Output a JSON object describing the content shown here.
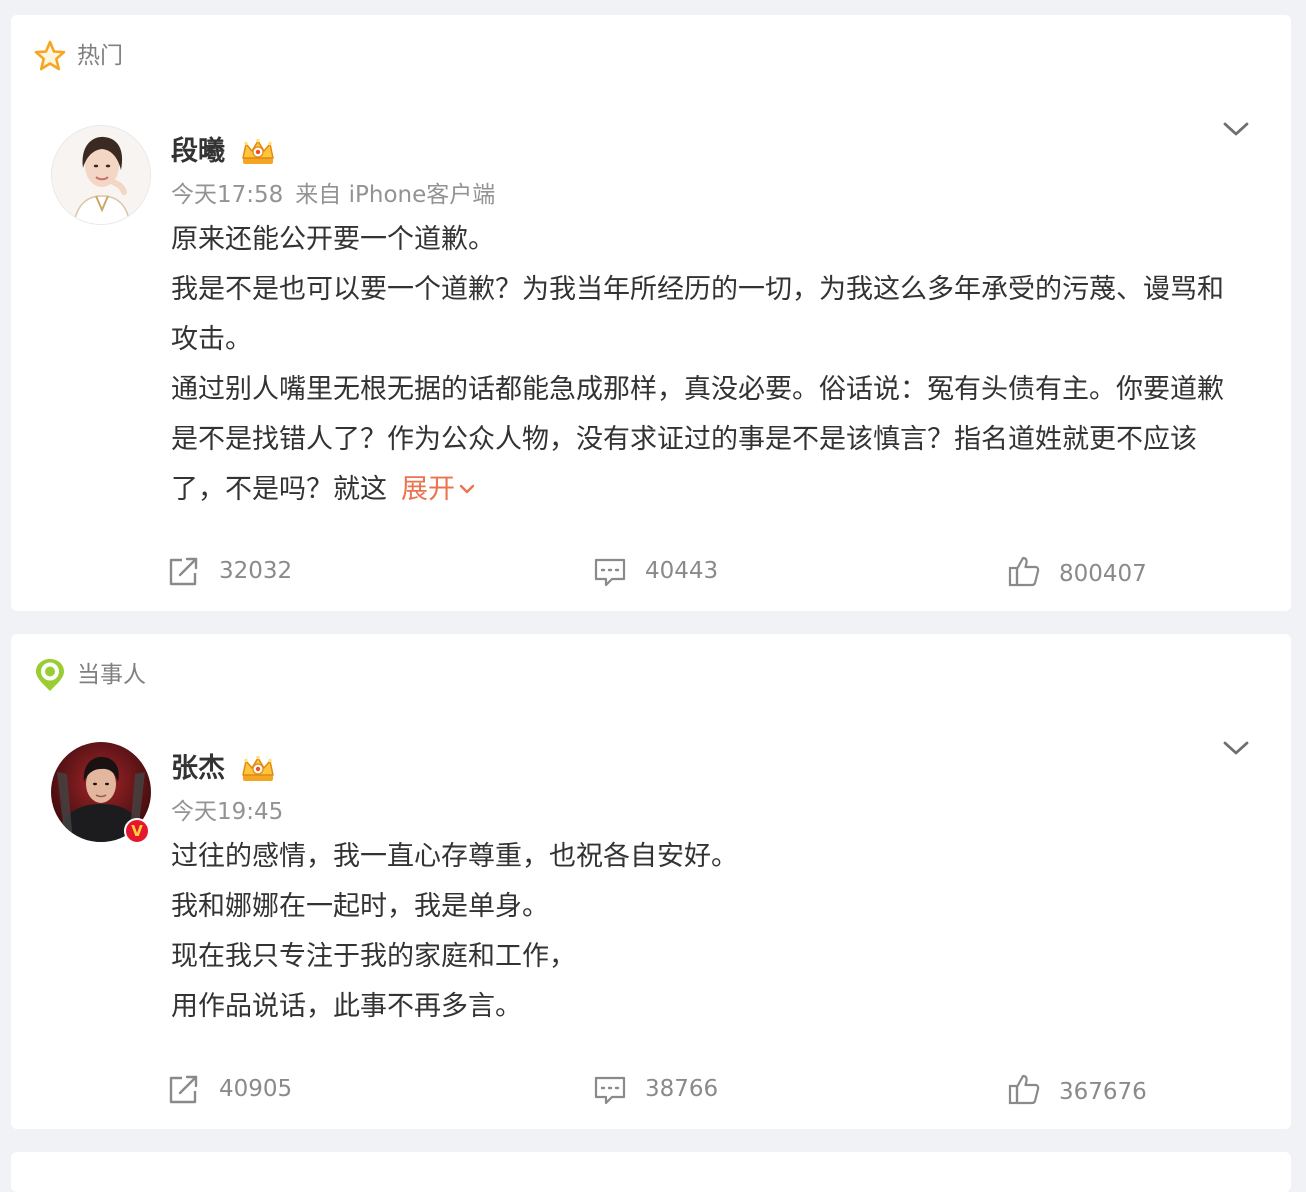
{
  "colors": {
    "page_background": "#f1f2f5",
    "card_background": "#ffffff",
    "accent_orange": "#eb7350",
    "star_orange": "#f6a623",
    "pin_green": "#9acd32",
    "verified_red": "#e6162d",
    "muted_text": "#939393"
  },
  "sections": [
    {
      "label": "热门",
      "icon": "star-icon",
      "post": {
        "author": "段曦",
        "badge_icon": "crown-badge-icon",
        "time": "今天17:58",
        "source": "来自 iPhone客户端",
        "paragraphs": [
          "原来还能公开要一个道歉。",
          "我是不是也可以要一个道歉？为我当年所经历的一切，为我这么多年承受的污蔑、谩骂和攻击。",
          "通过别人嘴里无根无据的话都能急成那样，真没必要。俗话说：冤有头债有主。你要道歉是不是找错人了？作为公众人物，没有求证过的事是不是该慎言？指名道姓就更不应该了，不是吗？就这"
        ],
        "expand_label": "展开",
        "repost_count": "32032",
        "comment_count": "40443",
        "like_count": "800407"
      }
    },
    {
      "label": "当事人",
      "icon": "location-pin-icon",
      "post": {
        "author": "张杰",
        "badge_icon": "crown-badge-icon",
        "verified": "V",
        "time": "今天19:45",
        "paragraphs": [
          "过往的感情，我一直心存尊重，也祝各自安好。",
          "我和娜娜在一起时，我是单身。",
          "现在我只专注于我的家庭和工作，",
          "用作品说话，此事不再多言。"
        ],
        "repost_count": "40905",
        "comment_count": "38766",
        "like_count": "367676"
      }
    }
  ]
}
